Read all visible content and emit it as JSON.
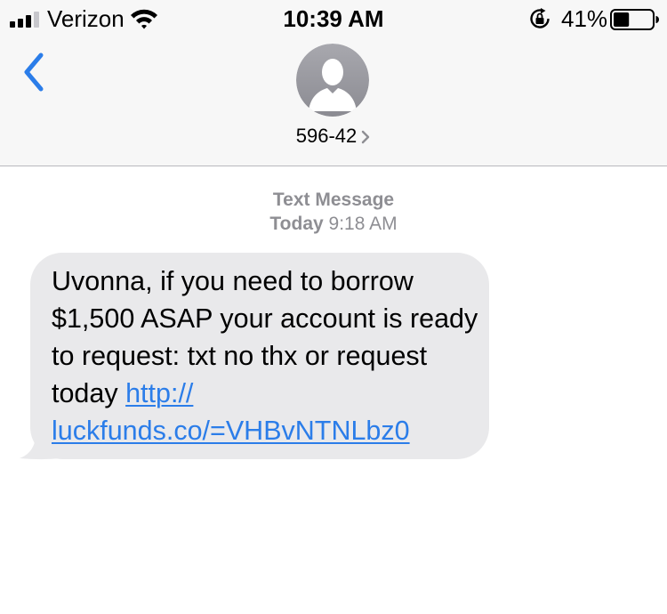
{
  "status_bar": {
    "carrier": "Verizon",
    "time": "10:39 AM",
    "battery_percent": "41%",
    "battery_level": 0.41,
    "signal_bars_filled": 3,
    "signal_bars_total": 4
  },
  "nav": {
    "back_icon": "chevron-left-icon",
    "avatar_icon": "person-silhouette-icon",
    "contact_name": "596-42",
    "contact_chevron_icon": "chevron-right-icon"
  },
  "conversation": {
    "message_type": "Text Message",
    "day": "Today",
    "time": "9:18 AM",
    "messages": [
      {
        "direction": "incoming",
        "text": "Uvonna, if you need to borrow $1,500 ASAP your account is ready to request: txt no thx or request today ",
        "link_line1": "http://",
        "link_line2": "luckfunds.co/=VHBvNTNLbz0"
      }
    ]
  },
  "colors": {
    "accent": "#2b7de9",
    "header_bg": "#f7f7f7",
    "bubble_bg": "#e9e9eb",
    "meta_text": "#8e8e93",
    "avatar_bg": "#9b9ba2"
  }
}
